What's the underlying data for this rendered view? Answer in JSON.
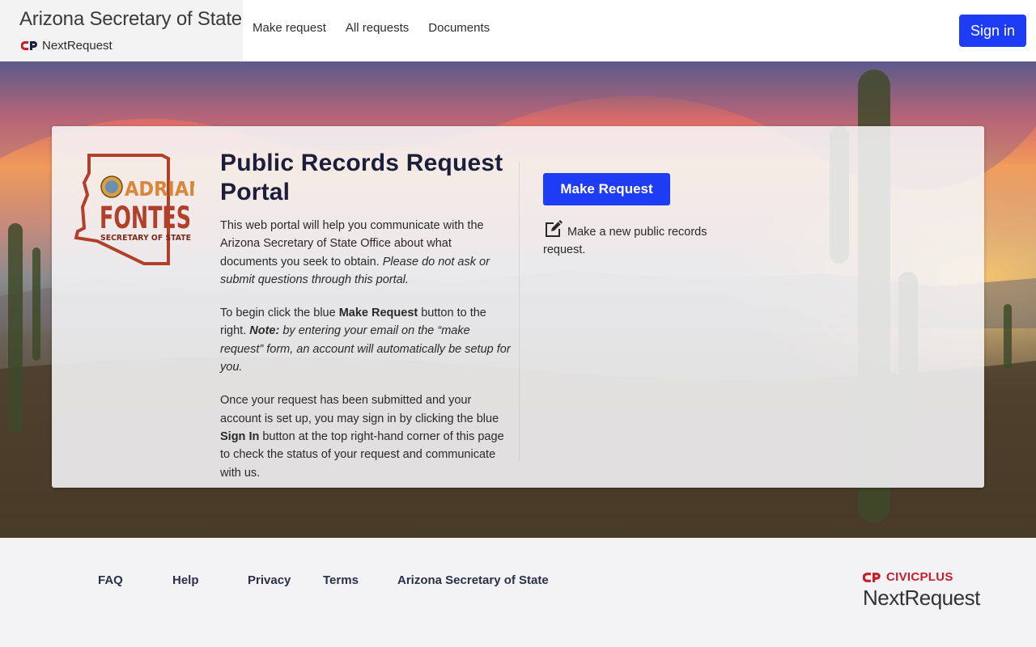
{
  "header": {
    "brand_title": "Arizona Secretary of State",
    "brand_product": "NextRequest",
    "nav": [
      "Make request",
      "All requests",
      "Documents"
    ],
    "sign_in": "Sign in"
  },
  "logo": {
    "line1": "ADRIAN",
    "line2": "FONTES",
    "line3": "SECRETARY OF STATE",
    "color": "#b0402a"
  },
  "main": {
    "title": "Public Records Request Portal",
    "p1_plain": "This web portal will help you communicate with the Arizona Secretary of State Office about what documents you seek to obtain. ",
    "p1_italic": "Please do not ask or submit questions through this portal.",
    "p2_a": "To begin click the blue ",
    "p2_bold": "Make Request",
    "p2_b": " button to the right. ",
    "p2_note": "Note:",
    "p2_italic": " by entering your email on the “make request” form, an account will automatically be setup for you.",
    "p3_a": "Once your request has been submitted and your account is set up, you may sign in by clicking the blue ",
    "p3_bold": "Sign In",
    "p3_b": " button at the top right-hand corner of this page to check the status of your request and communicate with us."
  },
  "action": {
    "button": "Make Request",
    "description": "Make a new public records request.",
    "icon": "edit-icon"
  },
  "footer": {
    "links": [
      "FAQ",
      "Help",
      "Privacy",
      "Terms",
      "Arizona Secretary of State"
    ],
    "civic_brand": "CIVICPLUS",
    "civic_product": "NextRequest"
  },
  "colors": {
    "primary": "#1f3cf5",
    "civic_red": "#c41e2a"
  }
}
